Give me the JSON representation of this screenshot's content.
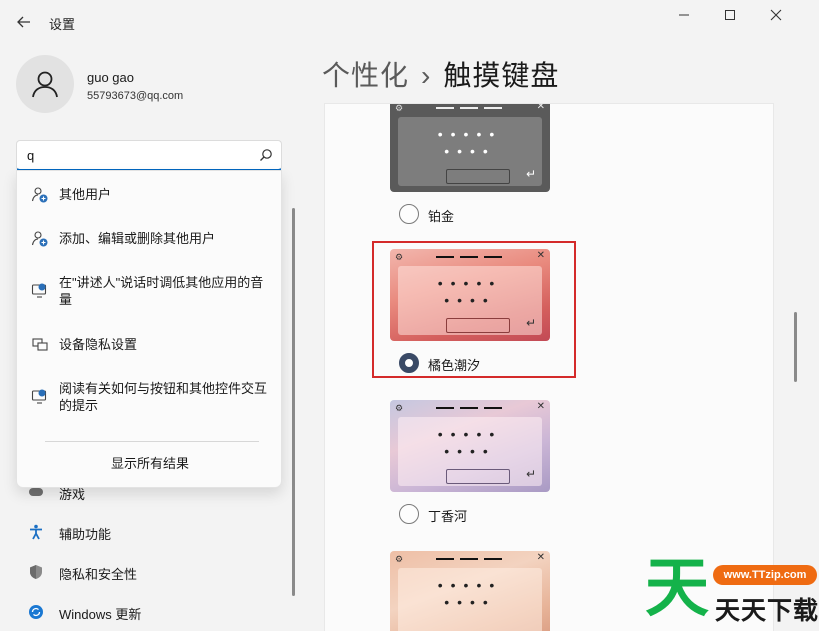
{
  "window": {
    "title": "设置"
  },
  "profile": {
    "name": "guo gao",
    "email": "55793673@qq.com"
  },
  "search": {
    "value": "q"
  },
  "search_results": {
    "items": [
      {
        "label": "其他用户",
        "icon": "add-user-icon"
      },
      {
        "label": "添加、编辑或删除其他用户",
        "icon": "add-user-icon"
      },
      {
        "label": "在\"讲述人\"说话时调低其他应用的音量",
        "icon": "narrator-icon"
      },
      {
        "label": "设备隐私设置",
        "icon": "device-privacy-icon"
      },
      {
        "label": "阅读有关如何与按钮和其他控件交互的提示",
        "icon": "narrator-icon"
      }
    ],
    "show_all": "显示所有结果"
  },
  "sidebar": {
    "items": [
      {
        "label": "游戏",
        "icon": "gamepad-icon"
      },
      {
        "label": "辅助功能",
        "icon": "accessibility-icon"
      },
      {
        "label": "隐私和安全性",
        "icon": "shield-icon"
      },
      {
        "label": "Windows 更新",
        "icon": "windows-update-icon"
      }
    ]
  },
  "breadcrumb": {
    "parent": "个性化",
    "separator": "›",
    "current": "触摸键盘"
  },
  "themes": [
    {
      "label": "铂金",
      "selected": false
    },
    {
      "label": "橘色潮汐",
      "selected": true
    },
    {
      "label": "丁香河",
      "selected": false
    },
    {
      "label": "",
      "selected": false
    }
  ],
  "watermark": {
    "big_char": "天",
    "site": "www.TTzip.com",
    "text": "天天下载"
  },
  "colors": {
    "accent": "#0067c0",
    "highlight": "#d42a2a",
    "radio_checked": "#3a4a66"
  }
}
